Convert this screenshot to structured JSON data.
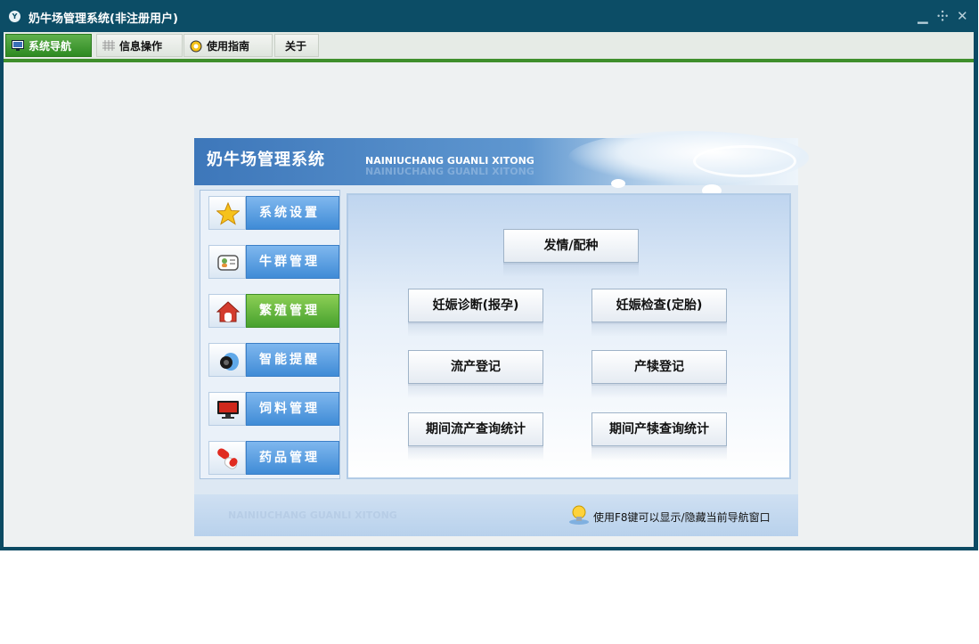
{
  "window": {
    "title": "奶牛场管理系统(非注册用户)",
    "app_icon_text": "Y",
    "controls": {
      "minimize": "▁",
      "restore": "⸭",
      "close": "✕"
    }
  },
  "menubar": {
    "tabs": [
      {
        "label": "系统导航",
        "icon": "monitor-icon",
        "active": true
      },
      {
        "label": "信息操作",
        "icon": "grid-icon",
        "active": false
      },
      {
        "label": "使用指南",
        "icon": "help-circle-icon",
        "active": false
      },
      {
        "label": "关于",
        "icon": "",
        "active": false
      }
    ]
  },
  "panel": {
    "title_cn": "奶牛场管理系统",
    "title_en": "NAINIUCHANG GUANLI XITONG",
    "sidebar": [
      {
        "label": "系统设置",
        "icon": "star-icon",
        "active": false
      },
      {
        "label": "牛群管理",
        "icon": "contacts-card-icon",
        "active": false
      },
      {
        "label": "繁殖管理",
        "icon": "house-icon",
        "active": true
      },
      {
        "label": "智能提醒",
        "icon": "speaker-icon",
        "active": false
      },
      {
        "label": "饲料管理",
        "icon": "monitor-icon",
        "active": false
      },
      {
        "label": "药品管理",
        "icon": "pill-icon",
        "active": false
      }
    ],
    "actions": [
      {
        "label": "发情/配种"
      },
      {
        "label": "妊娠诊断(报孕)"
      },
      {
        "label": "妊娠检查(定胎)"
      },
      {
        "label": "流产登记"
      },
      {
        "label": "产犊登记"
      },
      {
        "label": "期间流产查询统计"
      },
      {
        "label": "期间产犊查询统计"
      }
    ],
    "footer": {
      "watermark": "NAINIUCHANG GUANLI XITONG",
      "hint": "使用F8键可以显示/隐藏当前导航窗口"
    }
  },
  "colors": {
    "titlebar": "#0c4d66",
    "active_tab": "#2e8a22",
    "menubar_line": "#3f8f2c",
    "side_button_blue": "#3f8bd6",
    "side_button_green": "#47a12e"
  }
}
